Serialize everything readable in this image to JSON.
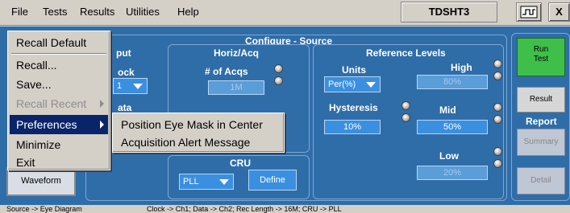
{
  "menubar": {
    "items": [
      "File",
      "Tests",
      "Results",
      "Utilities",
      "Help"
    ],
    "app_label": "TDSHT3",
    "close_label": "X"
  },
  "panels": {
    "configure_title": "Configure - Source",
    "input_title": "put",
    "clock_label": "ock",
    "clock_value": "1",
    "data_label": "ata",
    "horiz_title": "Horiz/Acq",
    "num_acqs_label": "# of Acqs",
    "num_acqs_value": "1M",
    "cru_title": "CRU",
    "cru_value": "PLL",
    "define_label": "Define",
    "ref_title": "Reference Levels",
    "units_label": "Units",
    "units_value": "Per(%)",
    "high_label": "High",
    "high_value": "80%",
    "hysteresis_label": "Hysteresis",
    "hysteresis_value": "10%",
    "mid_label": "Mid",
    "mid_value": "50%",
    "low_label": "Low",
    "low_value": "20%",
    "view_waveform_label": "Waveform"
  },
  "right_panel": {
    "run_test": "Run\nTest",
    "result": "Result",
    "report_title": "Report",
    "summary": "Summary",
    "detail": "Detail"
  },
  "file_menu": {
    "items": [
      {
        "label": "Recall Default",
        "state": "normal"
      },
      {
        "label": "Recall...",
        "state": "normal"
      },
      {
        "label": "Save...",
        "state": "normal"
      },
      {
        "label": "Recall Recent",
        "state": "disabled"
      },
      {
        "label": "Preferences",
        "state": "selected"
      },
      {
        "label": "Minimize",
        "state": "normal"
      },
      {
        "label": "Exit",
        "state": "normal"
      }
    ]
  },
  "preferences_menu": {
    "items": [
      "Position Eye Mask in Center",
      "Acquisition Alert Message"
    ]
  },
  "status": {
    "left": "Source -> Eye Diagram",
    "right": "Clock -> Ch1; Data -> Ch2; Rec Length -> 16M; CRU -> PLL"
  }
}
